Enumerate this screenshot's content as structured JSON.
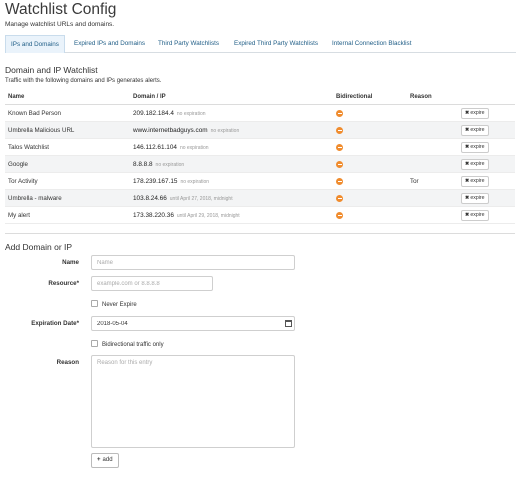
{
  "header": {
    "title": "Watchlist Config",
    "subtitle": "Manage watchlist URLs and domains."
  },
  "tabs": [
    {
      "label": "IPs and Domains",
      "active": true
    },
    {
      "label": "Expired IPs and Domains",
      "active": false
    },
    {
      "label": "Third Party Watchlists",
      "active": false
    },
    {
      "label": "Expired Third Party Watchlists",
      "active": false
    },
    {
      "label": "Internal Connection Blacklist",
      "active": false
    }
  ],
  "watchlist": {
    "title": "Domain and IP Watchlist",
    "description": "Traffic with the following domains and IPs generates alerts.",
    "columns": [
      "Name",
      "Domain / IP",
      "Bidirectional",
      "Reason"
    ],
    "rows": [
      {
        "name": "Known Bad Person",
        "value": "209.182.184.4",
        "note": "no expiration",
        "reason": "",
        "expire_label": "expire"
      },
      {
        "name": "Umbrella Malicious URL",
        "value": "www.internetbadguys.com",
        "note": "no expiration",
        "reason": "",
        "expire_label": "expire"
      },
      {
        "name": "Talos Watchlist",
        "value": "146.112.61.104",
        "note": "no expiration",
        "reason": "",
        "expire_label": "expire"
      },
      {
        "name": "Google",
        "value": "8.8.8.8",
        "note": "no expiration",
        "reason": "",
        "expire_label": "expire"
      },
      {
        "name": "Tor Activity",
        "value": "178.239.167.15",
        "note": "no expiration",
        "reason": "Tor",
        "expire_label": "expire"
      },
      {
        "name": "Umbrella - malware",
        "value": "103.8.24.66",
        "note": "until April 27, 2018, midnight",
        "reason": "",
        "expire_label": "expire"
      },
      {
        "name": "My alert",
        "value": "173.38.220.36",
        "note": "until April 29, 2018, midnight",
        "reason": "",
        "expire_label": "expire"
      }
    ]
  },
  "form": {
    "title": "Add Domain or IP",
    "name_label": "Name",
    "name_placeholder": "Name",
    "resource_label": "Resource*",
    "resource_placeholder": "example.com or 8.8.8.8",
    "never_expire_label": "Never Expire",
    "expiration_label": "Expiration Date*",
    "expiration_value": "2018-05-04",
    "bidirectional_label": "Bidirectional traffic only",
    "reason_label": "Reason",
    "reason_placeholder": "Reason for this entry",
    "add_label": "add"
  },
  "colors": {
    "accent": "#1f5d86",
    "bidirectional": "#f08c2e",
    "alt_row": "#f3f4f5"
  }
}
